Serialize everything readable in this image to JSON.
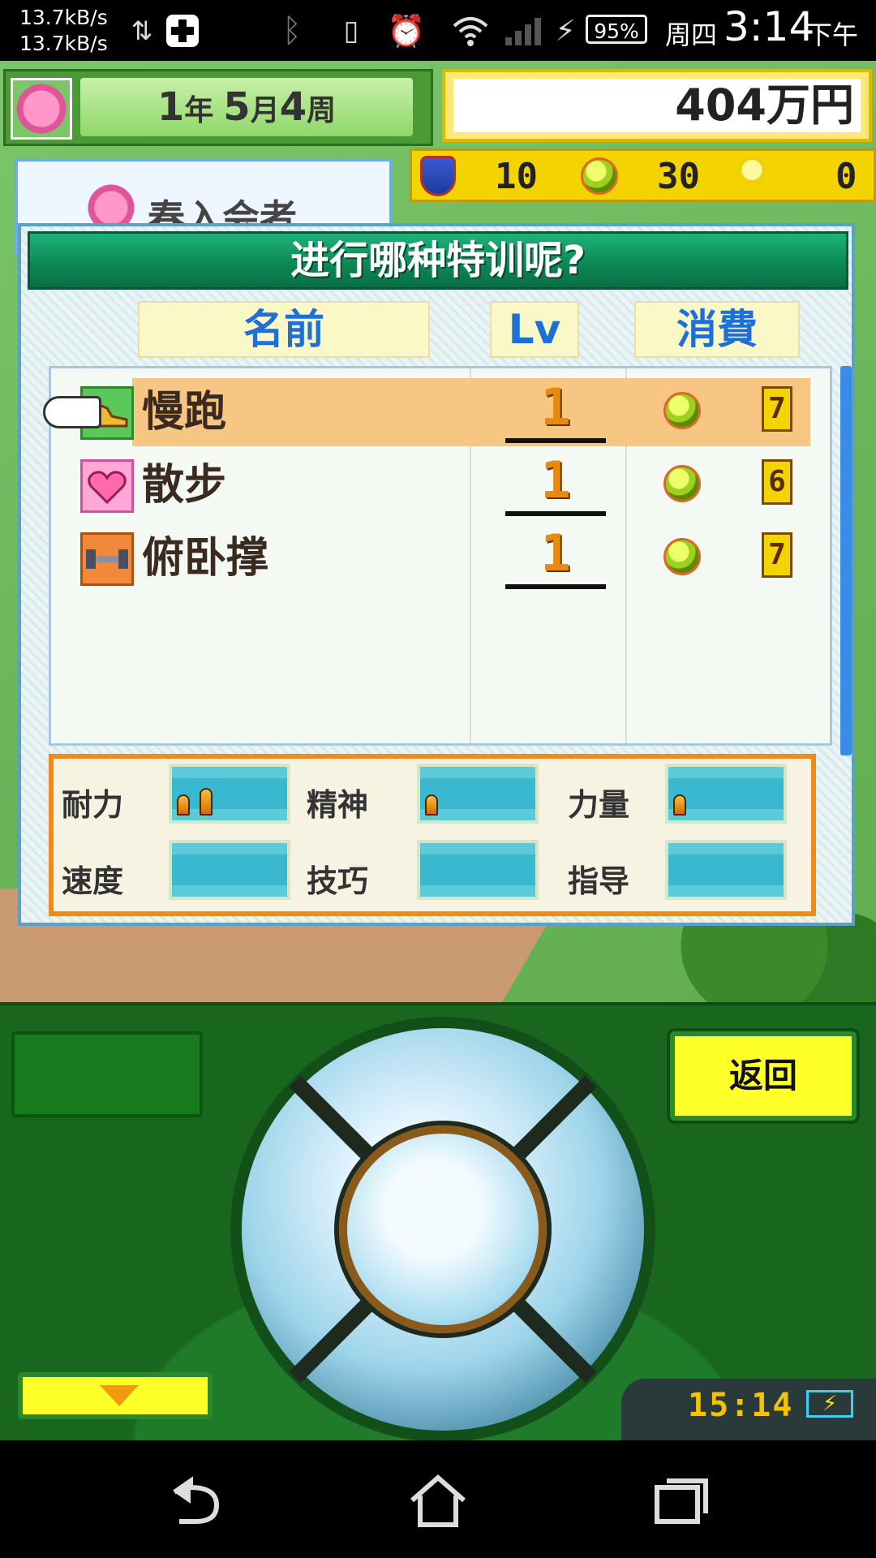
{
  "status_bar": {
    "net_up": "13.7kB/s",
    "net_down": "13.7kB/s",
    "battery": "95%",
    "weekday": "周四",
    "time": "3:14",
    "ampm": "下午"
  },
  "hud": {
    "year_num": "1",
    "year_label": "年",
    "month_num": "5",
    "month_label": "月",
    "week_num": "4",
    "week_label": "周",
    "money": "404万円",
    "resources": {
      "badges": "10",
      "balls": "30",
      "ideas": "0"
    },
    "background_member": "春入会者"
  },
  "dialog": {
    "title": "进行哪种特训呢?",
    "headers": {
      "name": "名前",
      "lv": "Lv",
      "cost": "消費"
    },
    "items": [
      {
        "name": "慢跑",
        "lv": "1",
        "cost": "7",
        "icon": "running-shoe-icon",
        "selected": true
      },
      {
        "name": "散步",
        "lv": "1",
        "cost": "6",
        "icon": "heart-icon",
        "selected": false
      },
      {
        "name": "俯卧撑",
        "lv": "1",
        "cost": "7",
        "icon": "dumbbell-icon",
        "selected": false
      }
    ],
    "stats": [
      {
        "label": "耐力",
        "pips": 2
      },
      {
        "label": "精神",
        "pips": 1
      },
      {
        "label": "力量",
        "pips": 1
      },
      {
        "label": "速度",
        "pips": 0
      },
      {
        "label": "技巧",
        "pips": 0
      },
      {
        "label": "指导",
        "pips": 0
      }
    ]
  },
  "controller": {
    "back_label": "返回",
    "clock": "15:14"
  },
  "colors": {
    "dialog_title_green": "#0d8a55",
    "header_blue": "#1f6fd8",
    "selected_row": "#f7c682",
    "stats_border": "#f08a1a",
    "button_yellow": "#ffff2a"
  }
}
